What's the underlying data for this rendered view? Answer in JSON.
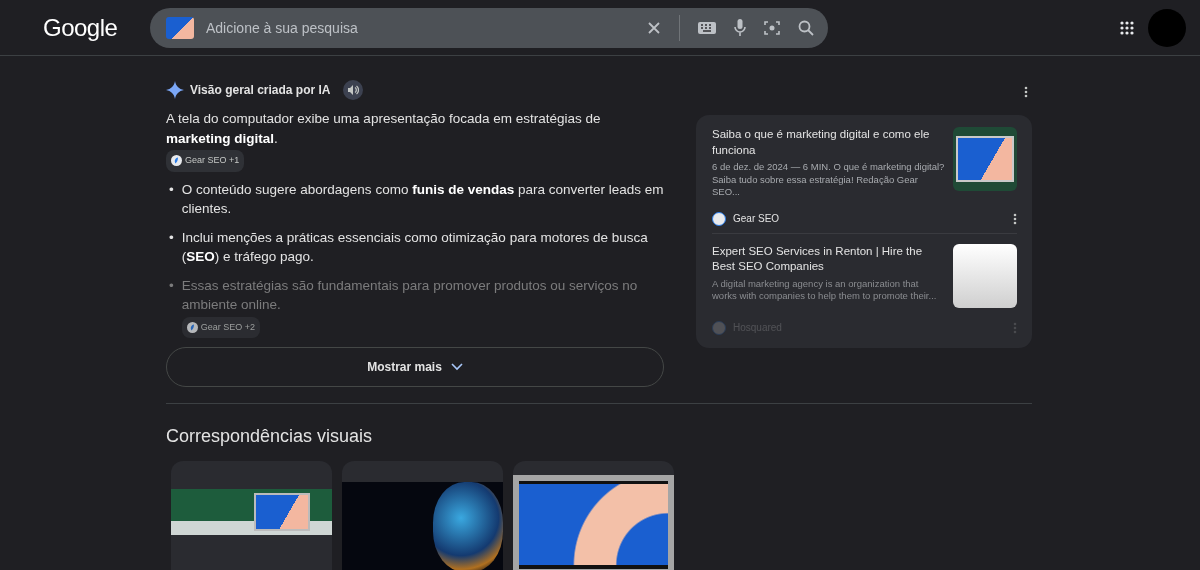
{
  "header": {
    "logo": "Google",
    "search": {
      "placeholder": "Adicione à sua pesquisa"
    }
  },
  "ai_overview": {
    "title": "Visão geral criada por IA",
    "intro": {
      "text": "A tela do computador exibe uma apresentação focada em estratégias de **marketing digital**.",
      "chip": "Gear SEO +1"
    },
    "bullets": [
      {
        "marker": "•",
        "text": "O conteúdo sugere abordagens como **funis de vendas** para converter leads em clientes.",
        "faded": false
      },
      {
        "marker": "•",
        "text": "Inclui menções a práticas essenciais como otimização para motores de busca (**SEO**) e tráfego pago.",
        "faded": false
      },
      {
        "marker": "•",
        "text": "Essas estratégias são fundamentais para promover produtos ou serviços no ambiente online.",
        "chip": "Gear SEO +2",
        "faded": true
      }
    ],
    "show_more": "Mostrar mais",
    "sources": [
      {
        "title": "Saiba o que é marketing digital e como ele funciona",
        "snippet": "6 de dez. de 2024 — 6 MIN. O que é marketing digital? Saiba tudo sobre essa estratégia! Redação Gear SEO...",
        "site": "Gear SEO",
        "kind": "laptop",
        "faded": false
      },
      {
        "title": "Expert SEO Services in Renton | Hire the Best SEO Companies",
        "snippet": "A digital marketing agency is an organization that works with companies to help them to promote their...",
        "site": "Hosquared",
        "kind": "logo",
        "faded": true
      }
    ]
  },
  "visual_matches": {
    "title": "Correspondências visuais",
    "items": [
      {
        "kind": "desk"
      },
      {
        "kind": "banner"
      },
      {
        "kind": "screen"
      }
    ]
  }
}
